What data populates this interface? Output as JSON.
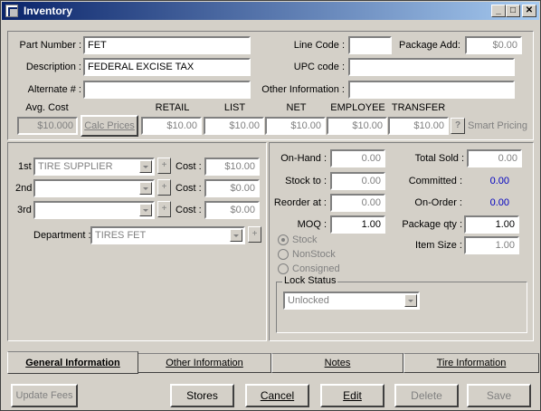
{
  "window": {
    "title": "Inventory",
    "minimize": "_",
    "maximize": "□",
    "close": "✕"
  },
  "part": {
    "part_number_label": "Part Number :",
    "part_number": "FET",
    "description_label": "Description :",
    "description": "FEDERAL EXCISE TAX",
    "alternate_label": "Alternate # :",
    "alternate": "",
    "line_code_label": "Line Code :",
    "line_code": "",
    "package_add_label": "Package Add:",
    "package_add": "$0.00",
    "upc_label": "UPC code :",
    "upc": "",
    "other_info_label": "Other Information :",
    "other_info": ""
  },
  "pricing": {
    "avg_cost_label": "Avg. Cost",
    "avg_cost": "$10.000",
    "calc_prices_label": "Calc Prices",
    "retail_label": "RETAIL",
    "retail": "$10.00",
    "list_label": "LIST",
    "list": "$10.00",
    "net_label": "NET",
    "net": "$10.00",
    "employee_label": "EMPLOYEE",
    "employee": "$10.00",
    "transfer_label": "TRANSFER",
    "transfer": "$10.00",
    "help_label": "?",
    "smart_pricing_label": "Smart Pricing"
  },
  "suppliers": {
    "rows": [
      {
        "label": "1st",
        "name": "TIRE SUPPLIER",
        "cost_label": "Cost :",
        "cost": "$10.00"
      },
      {
        "label": "2nd",
        "name": "",
        "cost_label": "Cost :",
        "cost": "$0.00"
      },
      {
        "label": "3rd",
        "name": "",
        "cost_label": "Cost :",
        "cost": "$0.00"
      }
    ],
    "plus": "+",
    "department_label": "Department :",
    "department": "TIRES FET"
  },
  "stock": {
    "on_hand_label": "On-Hand :",
    "on_hand": "0.00",
    "stock_to_label": "Stock to :",
    "stock_to": "0.00",
    "reorder_label": "Reorder at :",
    "reorder": "0.00",
    "moq_label": "MOQ :",
    "moq": "1.00",
    "total_sold_label": "Total Sold :",
    "total_sold": "0.00",
    "committed_label": "Committed :",
    "committed": "0.00",
    "on_order_label": "On-Order :",
    "on_order": "0.00",
    "package_qty_label": "Package qty :",
    "package_qty": "1.00",
    "item_size_label": "Item Size :",
    "item_size": "1.00",
    "radio_stock": "Stock",
    "radio_nonstock": "NonStock",
    "radio_consigned": "Consigned",
    "lock_status_label": "Lock Status",
    "lock_status": "Unlocked"
  },
  "tabs": [
    "General Information",
    "Other Information",
    "Notes",
    "Tire Information"
  ],
  "buttons": {
    "update_fees": "Update Fees",
    "stores": "Stores",
    "cancel": "Cancel",
    "edit": "Edit",
    "delete": "Delete",
    "save": "Save"
  }
}
